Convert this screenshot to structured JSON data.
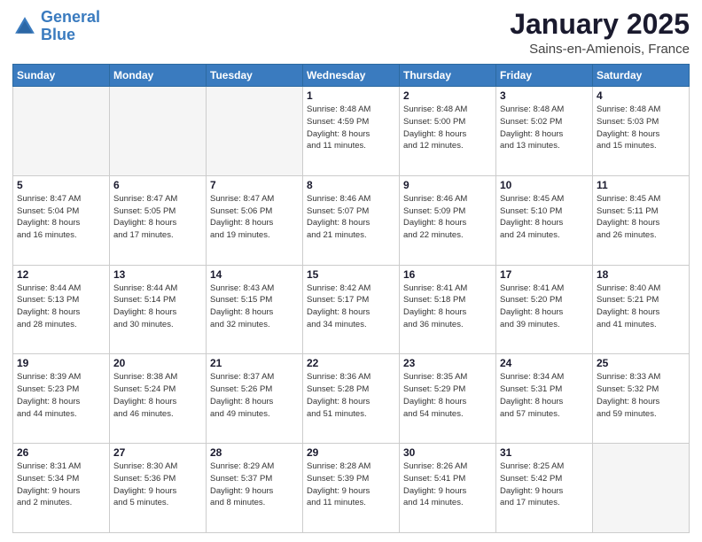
{
  "logo": {
    "line1": "General",
    "line2": "Blue"
  },
  "header": {
    "title": "January 2025",
    "subtitle": "Sains-en-Amienois, France"
  },
  "weekdays": [
    "Sunday",
    "Monday",
    "Tuesday",
    "Wednesday",
    "Thursday",
    "Friday",
    "Saturday"
  ],
  "weeks": [
    [
      {
        "day": "",
        "info": ""
      },
      {
        "day": "",
        "info": ""
      },
      {
        "day": "",
        "info": ""
      },
      {
        "day": "1",
        "info": "Sunrise: 8:48 AM\nSunset: 4:59 PM\nDaylight: 8 hours\nand 11 minutes."
      },
      {
        "day": "2",
        "info": "Sunrise: 8:48 AM\nSunset: 5:00 PM\nDaylight: 8 hours\nand 12 minutes."
      },
      {
        "day": "3",
        "info": "Sunrise: 8:48 AM\nSunset: 5:02 PM\nDaylight: 8 hours\nand 13 minutes."
      },
      {
        "day": "4",
        "info": "Sunrise: 8:48 AM\nSunset: 5:03 PM\nDaylight: 8 hours\nand 15 minutes."
      }
    ],
    [
      {
        "day": "5",
        "info": "Sunrise: 8:47 AM\nSunset: 5:04 PM\nDaylight: 8 hours\nand 16 minutes."
      },
      {
        "day": "6",
        "info": "Sunrise: 8:47 AM\nSunset: 5:05 PM\nDaylight: 8 hours\nand 17 minutes."
      },
      {
        "day": "7",
        "info": "Sunrise: 8:47 AM\nSunset: 5:06 PM\nDaylight: 8 hours\nand 19 minutes."
      },
      {
        "day": "8",
        "info": "Sunrise: 8:46 AM\nSunset: 5:07 PM\nDaylight: 8 hours\nand 21 minutes."
      },
      {
        "day": "9",
        "info": "Sunrise: 8:46 AM\nSunset: 5:09 PM\nDaylight: 8 hours\nand 22 minutes."
      },
      {
        "day": "10",
        "info": "Sunrise: 8:45 AM\nSunset: 5:10 PM\nDaylight: 8 hours\nand 24 minutes."
      },
      {
        "day": "11",
        "info": "Sunrise: 8:45 AM\nSunset: 5:11 PM\nDaylight: 8 hours\nand 26 minutes."
      }
    ],
    [
      {
        "day": "12",
        "info": "Sunrise: 8:44 AM\nSunset: 5:13 PM\nDaylight: 8 hours\nand 28 minutes."
      },
      {
        "day": "13",
        "info": "Sunrise: 8:44 AM\nSunset: 5:14 PM\nDaylight: 8 hours\nand 30 minutes."
      },
      {
        "day": "14",
        "info": "Sunrise: 8:43 AM\nSunset: 5:15 PM\nDaylight: 8 hours\nand 32 minutes."
      },
      {
        "day": "15",
        "info": "Sunrise: 8:42 AM\nSunset: 5:17 PM\nDaylight: 8 hours\nand 34 minutes."
      },
      {
        "day": "16",
        "info": "Sunrise: 8:41 AM\nSunset: 5:18 PM\nDaylight: 8 hours\nand 36 minutes."
      },
      {
        "day": "17",
        "info": "Sunrise: 8:41 AM\nSunset: 5:20 PM\nDaylight: 8 hours\nand 39 minutes."
      },
      {
        "day": "18",
        "info": "Sunrise: 8:40 AM\nSunset: 5:21 PM\nDaylight: 8 hours\nand 41 minutes."
      }
    ],
    [
      {
        "day": "19",
        "info": "Sunrise: 8:39 AM\nSunset: 5:23 PM\nDaylight: 8 hours\nand 44 minutes."
      },
      {
        "day": "20",
        "info": "Sunrise: 8:38 AM\nSunset: 5:24 PM\nDaylight: 8 hours\nand 46 minutes."
      },
      {
        "day": "21",
        "info": "Sunrise: 8:37 AM\nSunset: 5:26 PM\nDaylight: 8 hours\nand 49 minutes."
      },
      {
        "day": "22",
        "info": "Sunrise: 8:36 AM\nSunset: 5:28 PM\nDaylight: 8 hours\nand 51 minutes."
      },
      {
        "day": "23",
        "info": "Sunrise: 8:35 AM\nSunset: 5:29 PM\nDaylight: 8 hours\nand 54 minutes."
      },
      {
        "day": "24",
        "info": "Sunrise: 8:34 AM\nSunset: 5:31 PM\nDaylight: 8 hours\nand 57 minutes."
      },
      {
        "day": "25",
        "info": "Sunrise: 8:33 AM\nSunset: 5:32 PM\nDaylight: 8 hours\nand 59 minutes."
      }
    ],
    [
      {
        "day": "26",
        "info": "Sunrise: 8:31 AM\nSunset: 5:34 PM\nDaylight: 9 hours\nand 2 minutes."
      },
      {
        "day": "27",
        "info": "Sunrise: 8:30 AM\nSunset: 5:36 PM\nDaylight: 9 hours\nand 5 minutes."
      },
      {
        "day": "28",
        "info": "Sunrise: 8:29 AM\nSunset: 5:37 PM\nDaylight: 9 hours\nand 8 minutes."
      },
      {
        "day": "29",
        "info": "Sunrise: 8:28 AM\nSunset: 5:39 PM\nDaylight: 9 hours\nand 11 minutes."
      },
      {
        "day": "30",
        "info": "Sunrise: 8:26 AM\nSunset: 5:41 PM\nDaylight: 9 hours\nand 14 minutes."
      },
      {
        "day": "31",
        "info": "Sunrise: 8:25 AM\nSunset: 5:42 PM\nDaylight: 9 hours\nand 17 minutes."
      },
      {
        "day": "",
        "info": ""
      }
    ]
  ]
}
